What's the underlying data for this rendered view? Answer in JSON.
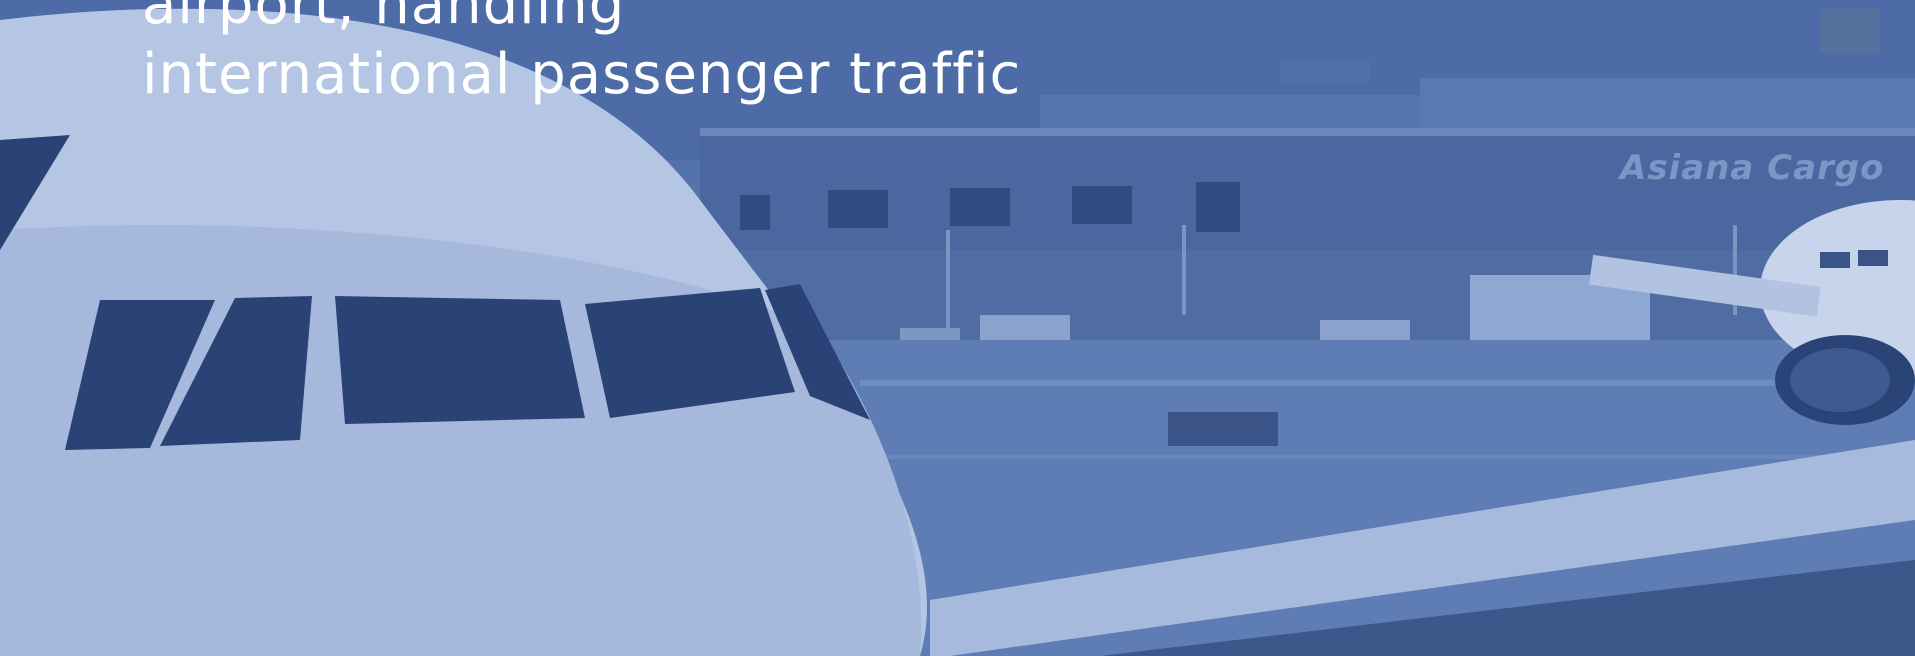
{
  "headline": {
    "line1": "airport, handling",
    "line2": "international passenger traffic"
  },
  "background": {
    "building_sign": "Asiana Cargo",
    "overlay_color": "#4f6fa9"
  }
}
